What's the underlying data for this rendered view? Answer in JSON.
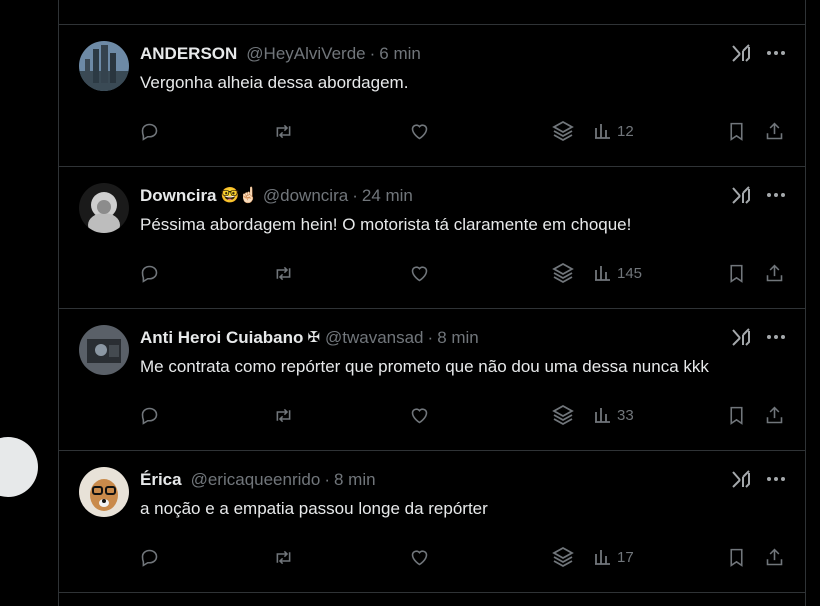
{
  "tweets": [
    {
      "name": "ANDERSON",
      "emoji": "",
      "handle": "@HeyAlviVerde",
      "dot": "·",
      "time": "6 min",
      "text": "Vergonha alheia dessa abordagem.",
      "views": "12"
    },
    {
      "name": "Downcira",
      "emoji": "🤓☝🏻",
      "handle": "@downcira",
      "dot": "·",
      "time": "24 min",
      "text": "Péssima abordagem hein! O motorista tá claramente em choque!",
      "views": "145"
    },
    {
      "name": "Anti Heroi Cuiabano",
      "emoji": "✠",
      "handle": "@twavansad",
      "dot": "·",
      "time": "8 min",
      "text": "Me contrata como repórter que prometo que não dou uma dessa nunca kkk",
      "views": "33"
    },
    {
      "name": "Érica",
      "emoji": "",
      "handle": "@ericaqueenrido",
      "dot": "·",
      "time": "8 min",
      "text": "a noção e a empatia passou longe da repórter",
      "views": "17"
    }
  ],
  "colors": {
    "background": "#000000",
    "border": "#2f3336",
    "primary_text": "#e7e9ea",
    "secondary_text": "#71767b"
  },
  "icons": [
    "reply-icon",
    "retweet-icon",
    "like-icon",
    "grok-layers-icon",
    "views-icon",
    "bookmark-icon",
    "share-icon",
    "grok-icon",
    "more-icon"
  ]
}
